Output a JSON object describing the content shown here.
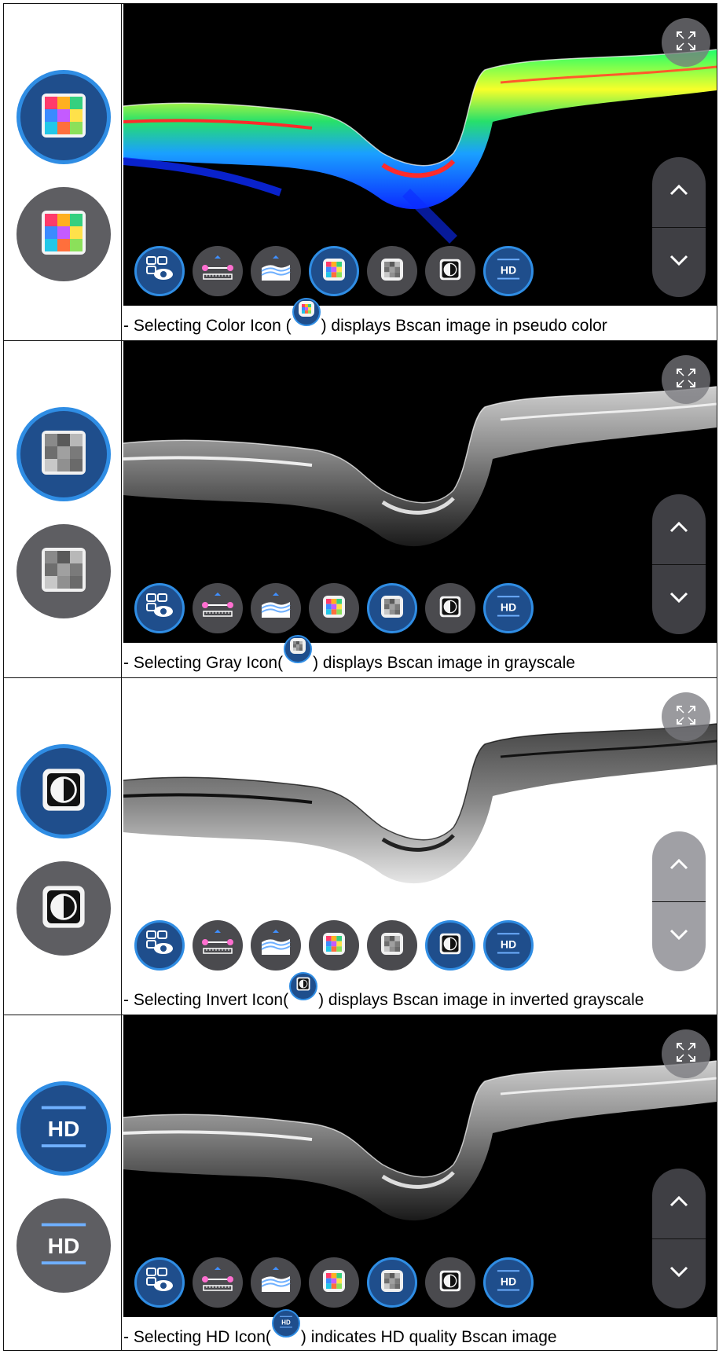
{
  "panels": [
    {
      "mode": "color",
      "big_icons": [
        "color-icon",
        "color-icon"
      ],
      "caption_pre": "- Selecting Color Icon (",
      "caption_post": ") displays Bscan image in pseudo color",
      "caption_icon": "color-icon",
      "selected_tool": "color"
    },
    {
      "mode": "gray",
      "big_icons": [
        "gray-icon",
        "gray-icon"
      ],
      "caption_pre": "- Selecting Gray Icon(",
      "caption_post": ") displays Bscan image in grayscale",
      "caption_icon": "gray-icon",
      "selected_tool": "gray"
    },
    {
      "mode": "invert",
      "big_icons": [
        "invert-icon",
        "invert-icon"
      ],
      "caption_pre": "- Selecting Invert Icon(",
      "caption_post": ") displays Bscan image in inverted grayscale",
      "caption_icon": "invert-icon",
      "selected_tool": "invert"
    },
    {
      "mode": "hd",
      "big_icons": [
        "hd-icon",
        "hd-icon"
      ],
      "caption_pre": "- Selecting HD Icon(",
      "caption_post": ") indicates HD quality Bscan image",
      "caption_icon": "hd-icon",
      "selected_tool": "gray"
    }
  ],
  "toolbar_items": [
    "eye-view-icon",
    "caliper-icon",
    "layers-icon",
    "color-icon",
    "gray-icon",
    "invert-icon",
    "hd-icon"
  ],
  "hd_label": "HD",
  "colors": {
    "selected_fill": "#1f4e8c",
    "selected_ring": "#2f8de4",
    "unselected_fill": "#5e5e62"
  }
}
